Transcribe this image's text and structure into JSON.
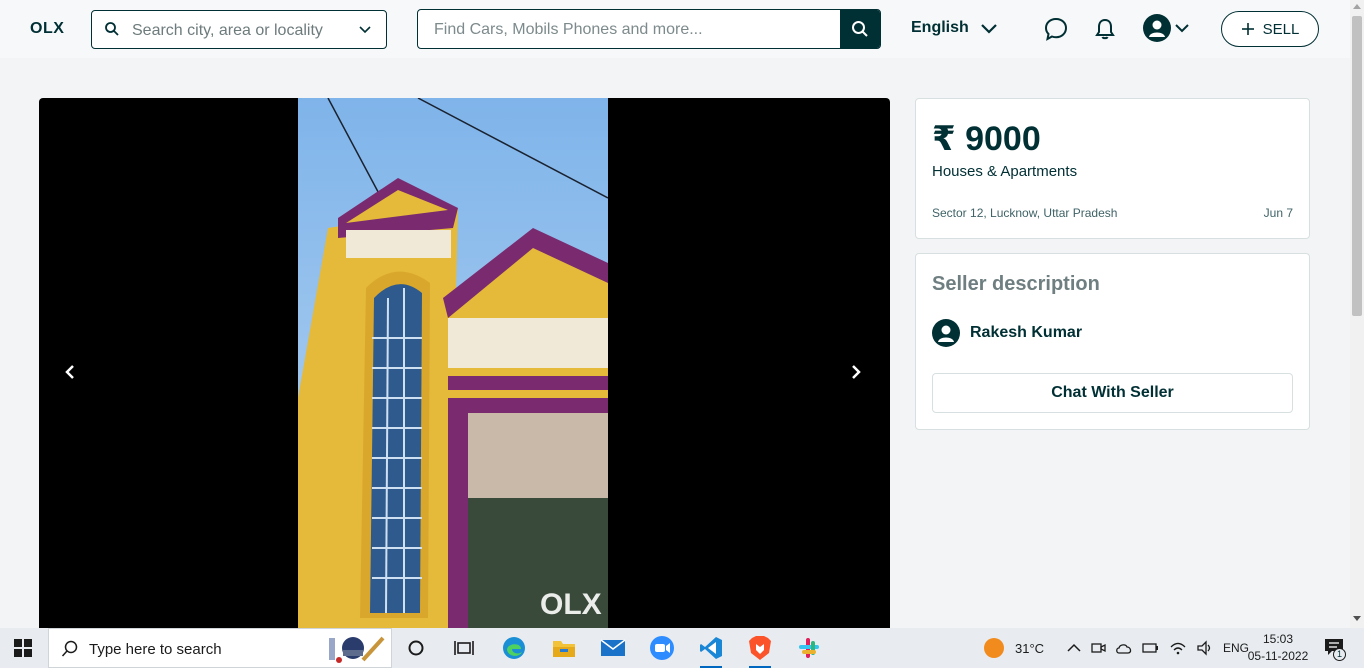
{
  "header": {
    "logo": "OLX",
    "location_placeholder": "Search city, area or locality",
    "search_placeholder": "Find Cars, Mobils Phones and more...",
    "language": "English",
    "sell_label": "SELL"
  },
  "gallery": {
    "watermark": "OLX"
  },
  "listing": {
    "price": "₹ 9000",
    "category": "Houses & Apartments",
    "location": "Sector 12, Lucknow, Uttar Pradesh",
    "date": "Jun 7"
  },
  "seller": {
    "title": "Seller description",
    "name": "Rakesh Kumar",
    "chat_label": "Chat With Seller"
  },
  "taskbar": {
    "search_text": "Type here to search",
    "temperature": "31°C",
    "language": "ENG",
    "time": "15:03",
    "date": "05-11-2022",
    "notification_count": "1"
  },
  "colors": {
    "brand_dark": "#002f34",
    "page_bg": "#f2f4f5"
  }
}
